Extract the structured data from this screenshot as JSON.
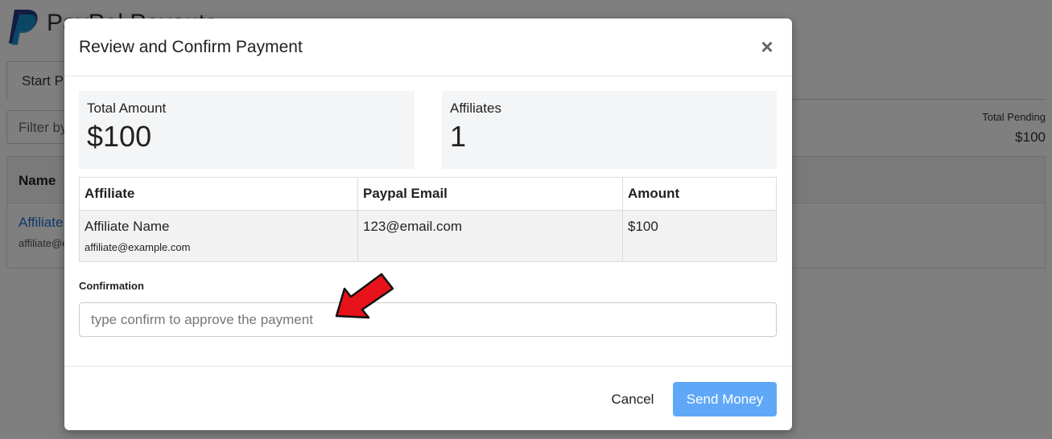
{
  "background": {
    "page_title": "PayPal Payouts",
    "tab_label": "Start Payout",
    "filter_placeholder": "Filter by name",
    "total_pending_label": "Total Pending",
    "total_pending_value": "$100",
    "table_header_name": "Name",
    "row_name": "Affiliate Name",
    "row_email": "affiliate@example.com"
  },
  "modal": {
    "title": "Review and Confirm Payment",
    "close_symbol": "×",
    "stats": {
      "total_amount_label": "Total Amount",
      "total_amount_value": "$100",
      "affiliates_label": "Affiliates",
      "affiliates_value": "1"
    },
    "table": {
      "headers": [
        "Affiliate",
        "Paypal Email",
        "Amount"
      ],
      "rows": [
        {
          "affiliate_name": "Affiliate Name",
          "affiliate_email": "affiliate@example.com",
          "paypal_email": "123@email.com",
          "amount": "$100"
        }
      ]
    },
    "confirmation": {
      "label": "Confirmation",
      "placeholder": "type confirm to approve the payment",
      "value": ""
    },
    "footer": {
      "cancel_label": "Cancel",
      "send_label": "Send Money"
    }
  },
  "colors": {
    "overlay": "#000000",
    "primary_button": "#5fa8f8",
    "arrow": "#e8121b",
    "link": "#1a73d4",
    "paypal_dark": "#253b80",
    "paypal_light": "#179bd7"
  },
  "icons": {
    "logo": "paypal-logo",
    "close": "close-icon",
    "annotation": "red-arrow-icon"
  }
}
